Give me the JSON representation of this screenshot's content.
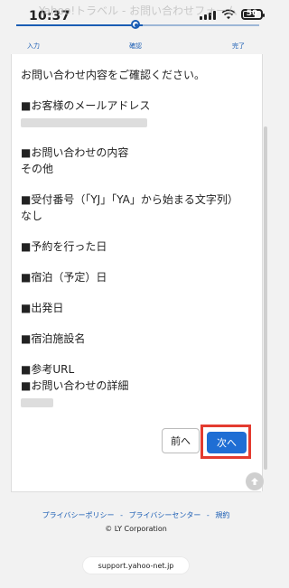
{
  "status_bar": {
    "time": "10:37",
    "battery": "50"
  },
  "header": {
    "page_title": "Yahoo!トラベル - お問い合わせフォーム",
    "steps": [
      {
        "label": "入力"
      },
      {
        "label": "確認"
      },
      {
        "label": "完了"
      }
    ],
    "active_step_index": 1
  },
  "form_confirm": {
    "intro": "お問い合わせ内容をご確認ください。",
    "fields": [
      {
        "label": "■お客様のメールアドレス",
        "value": ""
      },
      {
        "label": "■お問い合わせの内容",
        "value": "その他"
      },
      {
        "label": "■受付番号（「YJ」「YA」から始まる文字列）",
        "value": "なし"
      },
      {
        "label": "■予約を行った日",
        "value": ""
      },
      {
        "label": "■宿泊（予定）日",
        "value": ""
      },
      {
        "label": "■出発日",
        "value": ""
      },
      {
        "label": "■宿泊施設名",
        "value": ""
      },
      {
        "label": "■参考URL",
        "value": ""
      },
      {
        "label": "■お問い合わせの詳細",
        "value": ""
      }
    ]
  },
  "buttons": {
    "prev": "前へ",
    "next": "次へ"
  },
  "footer": {
    "links": [
      "プライバシーポリシー",
      "プライバシーセンター",
      "規約"
    ],
    "separator": "-",
    "copyright": "© LY Corporation"
  },
  "browser": {
    "url": "support.yahoo-net.jp"
  }
}
